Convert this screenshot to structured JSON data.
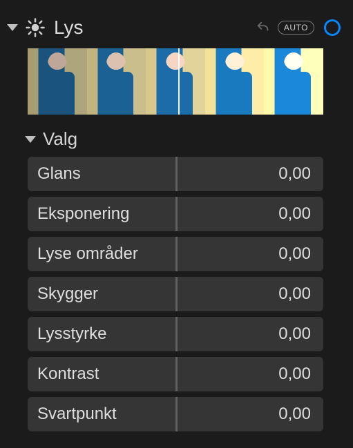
{
  "header": {
    "title": "Lys",
    "auto_label": "AUTO"
  },
  "options": {
    "label": "Valg"
  },
  "sliders": [
    {
      "label": "Glans",
      "value": "0,00"
    },
    {
      "label": "Eksponering",
      "value": "0,00"
    },
    {
      "label": "Lyse områder",
      "value": "0,00"
    },
    {
      "label": "Skygger",
      "value": "0,00"
    },
    {
      "label": "Lysstyrke",
      "value": "0,00"
    },
    {
      "label": "Kontrast",
      "value": "0,00"
    },
    {
      "label": "Svartpunkt",
      "value": "0,00"
    }
  ]
}
